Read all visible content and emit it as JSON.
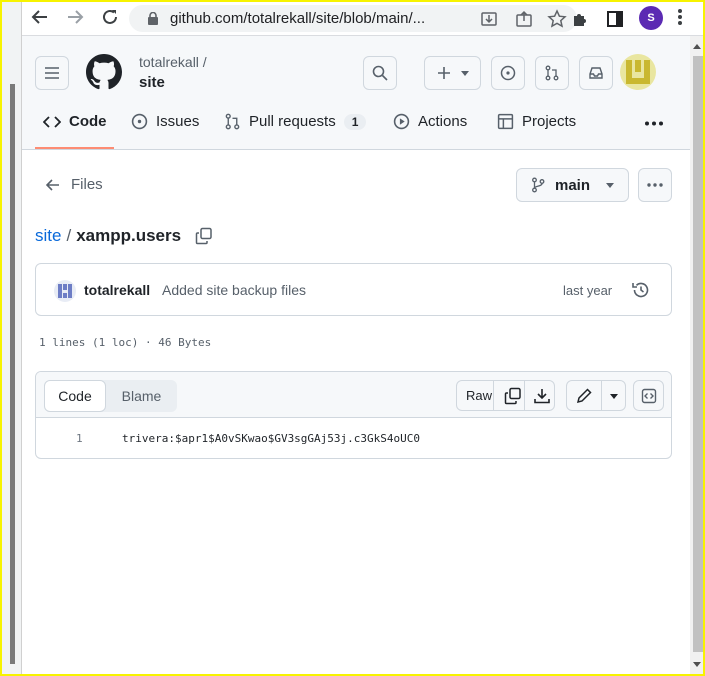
{
  "browser": {
    "url": "github.com/totalrekall/site/blob/main/...",
    "profile_initial": "S",
    "colors": {
      "profile": "#5b2ab3",
      "border_highlight": "#f7f300"
    }
  },
  "header": {
    "owner": "totalrekall /",
    "repo": "site",
    "tabs": [
      {
        "label": "Code",
        "icon": "code-icon"
      },
      {
        "label": "Issues",
        "icon": "issue-opened-icon"
      },
      {
        "label": "Pull requests",
        "icon": "git-pull-request-icon",
        "count": "1"
      },
      {
        "label": "Actions",
        "icon": "play-icon"
      },
      {
        "label": "Projects",
        "icon": "table-icon"
      }
    ]
  },
  "file_nav": {
    "back_label": "Files",
    "branch": "main"
  },
  "breadcrumb": {
    "repo_link": "site",
    "separator": "/",
    "file": "xampp.users"
  },
  "commit": {
    "author": "totalrekall",
    "message": "Added site backup files",
    "time": "last year"
  },
  "file_meta": "1 lines (1 loc) · 46 Bytes",
  "code_view": {
    "tabs": [
      "Code",
      "Blame"
    ],
    "raw_label": "Raw",
    "lines": [
      {
        "number": "1",
        "text": "trivera:$apr1$A0vSKwao$GV3sgGAj53j.c3GkS4oUC0"
      }
    ]
  }
}
